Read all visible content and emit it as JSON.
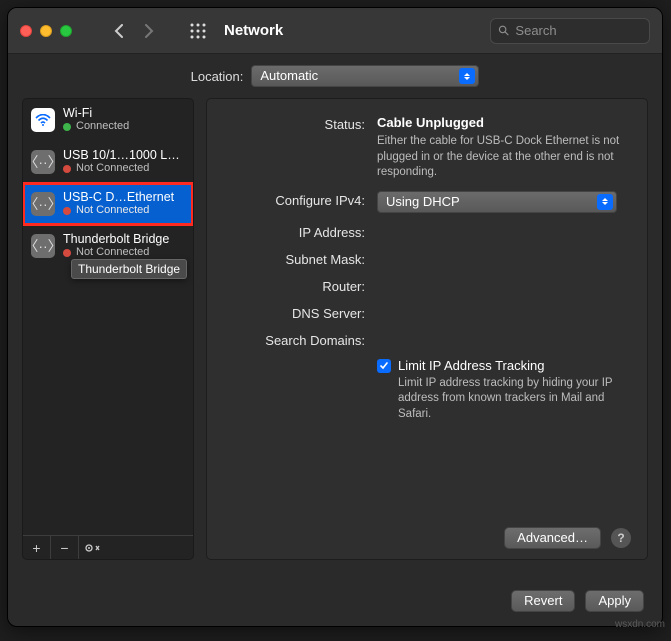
{
  "header": {
    "title": "Network",
    "search_placeholder": "Search"
  },
  "location": {
    "label": "Location:",
    "selected": "Automatic"
  },
  "sidebar": {
    "items": [
      {
        "name": "Wi-Fi",
        "status": "Connected",
        "dot": "green",
        "icon": "wifi"
      },
      {
        "name": "USB 10/1…1000 LAN",
        "status": "Not Connected",
        "dot": "red",
        "icon": "ethernet"
      },
      {
        "name": "USB-C D…Ethernet",
        "status": "Not Connected",
        "dot": "red",
        "icon": "ethernet"
      },
      {
        "name": "Thunderbolt Bridge",
        "status": "Not Connected",
        "dot": "red",
        "icon": "ethernet"
      }
    ],
    "tooltip": "Thunderbolt Bridge",
    "toolbar": {
      "add": "+",
      "remove": "−",
      "more": "⊙⌄"
    }
  },
  "detail": {
    "status_label": "Status:",
    "status_value": "Cable Unplugged",
    "status_hint": "Either the cable for USB-C Dock Ethernet is not plugged in or the device at the other end is not responding.",
    "ipv4_label": "Configure IPv4:",
    "ipv4_value": "Using DHCP",
    "ip_label": "IP Address:",
    "mask_label": "Subnet Mask:",
    "router_label": "Router:",
    "dns_label": "DNS Server:",
    "search_label": "Search Domains:",
    "limit_label": "Limit IP Address Tracking",
    "limit_hint": "Limit IP address tracking by hiding your IP address from known trackers in Mail and Safari.",
    "advanced": "Advanced…",
    "help": "?"
  },
  "footer": {
    "revert": "Revert",
    "apply": "Apply"
  },
  "watermark": "wsxdn.com"
}
